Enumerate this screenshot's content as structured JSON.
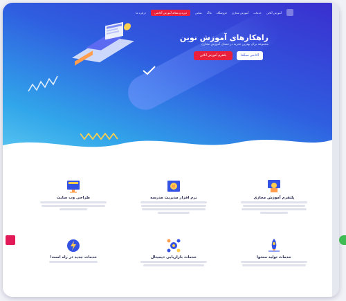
{
  "colors": {
    "hero_start": "#3a2fcf",
    "hero_end": "#5cc7f0",
    "accent_red": "#e8203c",
    "title_dark": "#2c2f56",
    "whatsapp_green": "#3fbd54"
  },
  "nav": {
    "cta": "دوره و مقاله آموزش آکادمی",
    "items": [
      "درباره ما",
      "تماس",
      "بلاگ",
      "فروشگاه",
      "آموزش مجازی",
      "خدمات",
      "آموزش آنلاین"
    ]
  },
  "hero": {
    "title": "راهکارهای آموزش نوین",
    "subtitle": "مجموعه برای بهترین تجربه در فضای آموزش مجازی",
    "primary_button": "پلتفرم آموزش آنلاین",
    "secondary_button": "آکادمی سیگما"
  },
  "features": [
    {
      "icon": "teacher-icon",
      "title": "پلتفرم آموزش مجازی"
    },
    {
      "icon": "school-map-icon",
      "title": "نرم افزار مدیریت مدرسه"
    },
    {
      "icon": "website-design-icon",
      "title": "طراحی وب سایت"
    },
    {
      "icon": "rocket-icon",
      "title": "خدمات تولید محتوا"
    },
    {
      "icon": "digital-marketing-icon",
      "title": "خدمات بازاریابی دیجیتال"
    },
    {
      "icon": "lightning-icon",
      "title": "خدمات جدید در راه است!"
    }
  ],
  "side_widgets": {
    "bookmark_icon": "bookmark-icon",
    "whatsapp_icon": "whatsapp-icon"
  }
}
